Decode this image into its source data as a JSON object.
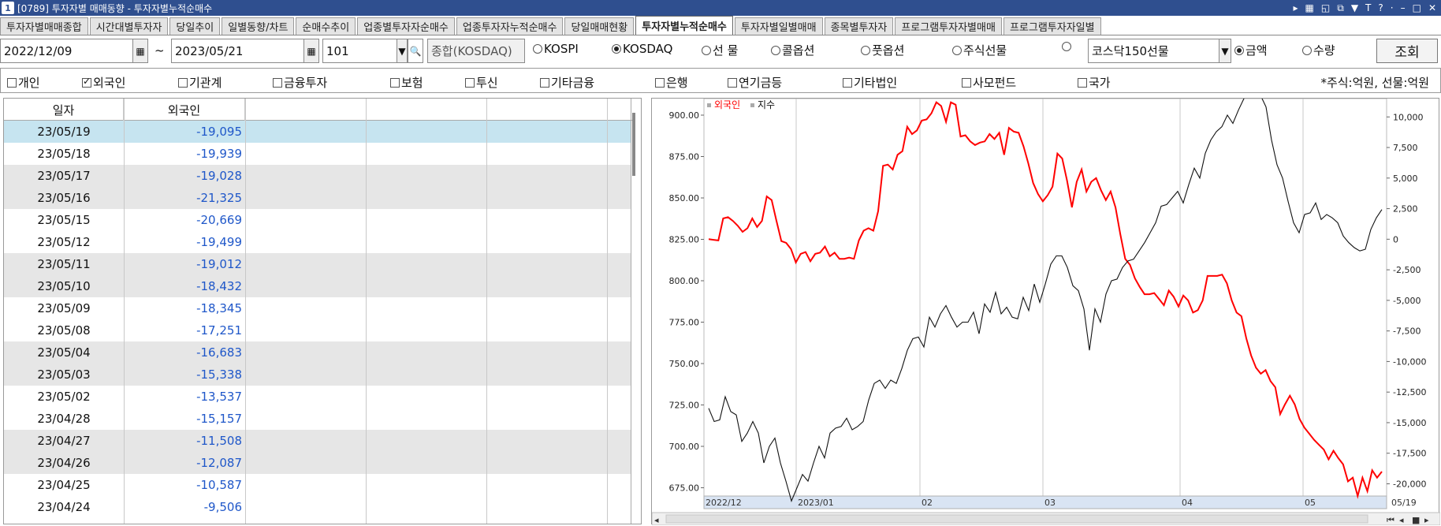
{
  "window": {
    "title": "[0789] 투자자별 매매동향 - 투자자별누적순매수",
    "app_number": "1"
  },
  "tabs": [
    {
      "label": "투자자별매매종합",
      "active": false
    },
    {
      "label": "시간대별투자자",
      "active": false
    },
    {
      "label": "당일추이",
      "active": false
    },
    {
      "label": "일별동향/차트",
      "active": false
    },
    {
      "label": "순매수추이",
      "active": false
    },
    {
      "label": "업종별투자자순매수",
      "active": false
    },
    {
      "label": "업종투자자누적순매수",
      "active": false
    },
    {
      "label": "당일매매현황",
      "active": false
    },
    {
      "label": "투자자별누적순매수",
      "active": true
    },
    {
      "label": "투자자별일별매매",
      "active": false
    },
    {
      "label": "종목별투자자",
      "active": false
    },
    {
      "label": "프로그램투자자별매매",
      "active": false
    },
    {
      "label": "프로그램투자자일별",
      "active": false
    }
  ],
  "query": {
    "start_date": "2022/12/09",
    "tilde": "~",
    "end_date": "2023/05/21",
    "code": "101",
    "market_name": "종합(KOSDAQ)",
    "markets": [
      {
        "label": "KOSPI",
        "selected": false
      },
      {
        "label": "KOSDAQ",
        "selected": true
      },
      {
        "label": "선 물",
        "selected": false
      },
      {
        "label": "콜옵션",
        "selected": false
      },
      {
        "label": "풋옵션",
        "selected": false
      },
      {
        "label": "주식선물",
        "selected": false
      },
      {
        "label": "",
        "selected": false
      }
    ],
    "futures_select": "코스닥150선물",
    "value_modes": [
      {
        "label": "금액",
        "selected": true
      },
      {
        "label": "수량",
        "selected": false
      }
    ],
    "search_label": "조회"
  },
  "investors": [
    {
      "label": "개인",
      "checked": false
    },
    {
      "label": "외국인",
      "checked": true
    },
    {
      "label": "기관계",
      "checked": false
    },
    {
      "label": "금융투자",
      "checked": false
    },
    {
      "label": "보험",
      "checked": false
    },
    {
      "label": "투신",
      "checked": false
    },
    {
      "label": "기타금융",
      "checked": false
    },
    {
      "label": "은행",
      "checked": false
    },
    {
      "label": "연기금등",
      "checked": false
    },
    {
      "label": "기타법인",
      "checked": false
    },
    {
      "label": "사모펀드",
      "checked": false
    },
    {
      "label": "국가",
      "checked": false
    }
  ],
  "unit_note": "*주식:억원, 선물:억원",
  "grid": {
    "headers": [
      "일자",
      "외국인"
    ],
    "rows": [
      {
        "date": "23/05/19",
        "value": "-19,095"
      },
      {
        "date": "23/05/18",
        "value": "-19,939"
      },
      {
        "date": "23/05/17",
        "value": "-19,028"
      },
      {
        "date": "23/05/16",
        "value": "-21,325"
      },
      {
        "date": "23/05/15",
        "value": "-20,669"
      },
      {
        "date": "23/05/12",
        "value": "-19,499"
      },
      {
        "date": "23/05/11",
        "value": "-19,012"
      },
      {
        "date": "23/05/10",
        "value": "-18,432"
      },
      {
        "date": "23/05/09",
        "value": "-18,345"
      },
      {
        "date": "23/05/08",
        "value": "-17,251"
      },
      {
        "date": "23/05/04",
        "value": "-16,683"
      },
      {
        "date": "23/05/03",
        "value": "-15,338"
      },
      {
        "date": "23/05/02",
        "value": "-13,537"
      },
      {
        "date": "23/04/28",
        "value": "-15,157"
      },
      {
        "date": "23/04/27",
        "value": "-11,508"
      },
      {
        "date": "23/04/26",
        "value": "-12,087"
      },
      {
        "date": "23/04/25",
        "value": "-10,587"
      },
      {
        "date": "23/04/24",
        "value": "-9,506"
      }
    ]
  },
  "chart_data": {
    "type": "line",
    "legend": [
      "외국인",
      "지수"
    ],
    "x_labels": [
      "2022/12",
      "2023/01",
      "02",
      "03",
      "04",
      "05",
      "05/19"
    ],
    "left_axis_ticks": [
      "900.00",
      "875.00",
      "850.00",
      "825.00",
      "800.00",
      "775.00",
      "750.00",
      "725.00",
      "700.00",
      "675.00"
    ],
    "right_axis_ticks": [
      "10,000",
      "7,500",
      "5,000",
      "2,500",
      "0",
      "-2,500",
      "-5,000",
      "-7,500",
      "-10,000",
      "-12,500",
      "-15,000",
      "-17,500",
      "-20,000"
    ],
    "left_range": [
      670,
      910
    ],
    "right_range": [
      -21000,
      11500
    ],
    "series": [
      {
        "name": "외국인",
        "color": "#ff0000",
        "axis": "right",
        "values": [
          0,
          -50,
          -100,
          1700,
          1800,
          1500,
          1100,
          600,
          900,
          1700,
          1000,
          1500,
          3500,
          3200,
          1500,
          -150,
          -300,
          -800,
          -1900,
          -1200,
          -1050,
          -1800,
          -1200,
          -1100,
          -600,
          -1400,
          -1100,
          -1600,
          -1600,
          -1500,
          -1600,
          -100,
          700,
          900,
          700,
          2300,
          6000,
          6100,
          5700,
          6900,
          7200,
          9200,
          8600,
          8900,
          9700,
          9800,
          10300,
          11200,
          10900,
          9600,
          11200,
          11000,
          8400,
          8500,
          8000,
          7700,
          7900,
          8000,
          8600,
          8200,
          8700,
          6900,
          9100,
          8800,
          8700,
          7600,
          6200,
          4600,
          3700,
          3100,
          3600,
          4300,
          7000,
          6600,
          4800,
          2600,
          4700,
          5700,
          3900,
          4700,
          5000,
          4000,
          3200,
          3900,
          2600,
          400,
          -1600,
          -2100,
          -3200,
          -3900,
          -4500,
          -4500,
          -4400,
          -4900,
          -5400,
          -4200,
          -4700,
          -5500,
          -4600,
          -5000,
          -6000,
          -5800,
          -5000,
          -3000,
          -3000,
          -3000,
          -2900,
          -3600,
          -5000,
          -6000,
          -6300,
          -8100,
          -9500,
          -10500,
          -11000,
          -10700,
          -11600,
          -12100,
          -14300,
          -13500,
          -12800,
          -13500,
          -14700,
          -15400,
          -15900,
          -16400,
          -16800,
          -17200,
          -18000,
          -17300,
          -17900,
          -18400,
          -19800,
          -19500,
          -21000,
          -19500,
          -20600,
          -18900,
          -19500,
          -19000
        ]
      },
      {
        "name": "지수",
        "color": "#111111",
        "axis": "left",
        "values": [
          723,
          715,
          716,
          730,
          721,
          719,
          703,
          708,
          715,
          708,
          690,
          700,
          705,
          690,
          679,
          667,
          675,
          683,
          679,
          690,
          700,
          693,
          708,
          711,
          712,
          717,
          710,
          712,
          715,
          728,
          738,
          740,
          735,
          740,
          738,
          747,
          758,
          765,
          766,
          760,
          778,
          772,
          780,
          785,
          778,
          772,
          775,
          775,
          781,
          768,
          786,
          781,
          793,
          780,
          784,
          778,
          777,
          790,
          782,
          798,
          787,
          798,
          810,
          815,
          815,
          808,
          797,
          794,
          783,
          758,
          783,
          775,
          792,
          800,
          801,
          808,
          812,
          813,
          818,
          823,
          829,
          835,
          845,
          846,
          850,
          854,
          847,
          858,
          868,
          862,
          877,
          885,
          890,
          893,
          900,
          895,
          903,
          910,
          913,
          912,
          912,
          905,
          885,
          870,
          862,
          848,
          835,
          829,
          840,
          841,
          847,
          837,
          840,
          838,
          835,
          827,
          823,
          820,
          818,
          819,
          831,
          838,
          843
        ]
      }
    ]
  }
}
